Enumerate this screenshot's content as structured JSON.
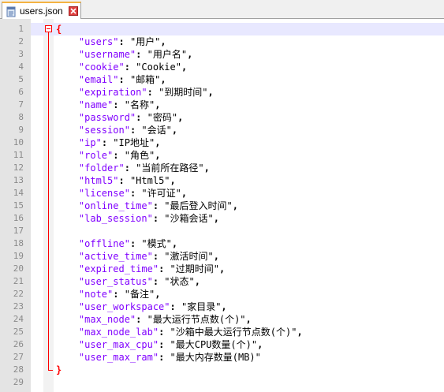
{
  "tab": {
    "label": "users.json",
    "icon": "file-icon",
    "close_icon": "close-icon"
  },
  "colors": {
    "key": "#8000ff",
    "brace": "#ff0000",
    "current_line": "#e8e8ff",
    "tab_accent": "#f4b342"
  },
  "lines": [
    {
      "n": "1",
      "type": "open",
      "text": "{"
    },
    {
      "n": "2",
      "type": "kv",
      "key": "\"users\"",
      "value": "\"用户\"",
      "comma": ","
    },
    {
      "n": "3",
      "type": "kv",
      "key": "\"username\"",
      "value": "\"用户名\"",
      "comma": ","
    },
    {
      "n": "4",
      "type": "kv",
      "key": "\"cookie\"",
      "value": "\"Cookie\"",
      "comma": ","
    },
    {
      "n": "5",
      "type": "kv",
      "key": "\"email\"",
      "value": "\"邮箱\"",
      "comma": ","
    },
    {
      "n": "6",
      "type": "kv",
      "key": "\"expiration\"",
      "value": "\"到期时间\"",
      "comma": ","
    },
    {
      "n": "7",
      "type": "kv",
      "key": "\"name\"",
      "value": "\"名称\"",
      "comma": ","
    },
    {
      "n": "8",
      "type": "kv",
      "key": "\"password\"",
      "value": "\"密码\"",
      "comma": ","
    },
    {
      "n": "9",
      "type": "kv",
      "key": "\"session\"",
      "value": "\"会话\"",
      "comma": ","
    },
    {
      "n": "10",
      "type": "kv",
      "key": "\"ip\"",
      "value": "\"IP地址\"",
      "comma": ","
    },
    {
      "n": "11",
      "type": "kv",
      "key": "\"role\"",
      "value": "\"角色\"",
      "comma": ","
    },
    {
      "n": "12",
      "type": "kv",
      "key": "\"folder\"",
      "value": "\"当前所在路径\"",
      "comma": ","
    },
    {
      "n": "13",
      "type": "kv",
      "key": "\"html5\"",
      "value": "\"Html5\"",
      "comma": ","
    },
    {
      "n": "14",
      "type": "kv",
      "key": "\"license\"",
      "value": "\"许可证\"",
      "comma": ","
    },
    {
      "n": "15",
      "type": "kv",
      "key": "\"online_time\"",
      "value": "\"最后登入时间\"",
      "comma": ","
    },
    {
      "n": "16",
      "type": "kv",
      "key": "\"lab_session\"",
      "value": "\"沙箱会话\"",
      "comma": ","
    },
    {
      "n": "17",
      "type": "blank"
    },
    {
      "n": "18",
      "type": "kv",
      "key": "\"offline\"",
      "value": "\"模式\"",
      "comma": ","
    },
    {
      "n": "19",
      "type": "kv",
      "key": "\"active_time\"",
      "value": "\"激活时间\"",
      "comma": ","
    },
    {
      "n": "20",
      "type": "kv",
      "key": "\"expired_time\"",
      "value": "\"过期时间\"",
      "comma": ","
    },
    {
      "n": "21",
      "type": "kv",
      "key": "\"user_status\"",
      "value": "\"状态\"",
      "comma": ","
    },
    {
      "n": "22",
      "type": "kv",
      "key": "\"note\"",
      "value": "\"备注\"",
      "comma": ","
    },
    {
      "n": "23",
      "type": "kv",
      "key": "\"user_workspace\"",
      "value": "\"家目录\"",
      "comma": ","
    },
    {
      "n": "24",
      "type": "kv",
      "key": "\"max_node\"",
      "value": "\"最大运行节点数(个)\"",
      "comma": ","
    },
    {
      "n": "25",
      "type": "kv",
      "key": "\"max_node_lab\"",
      "value": "\"沙箱中最大运行节点数(个)\"",
      "comma": ","
    },
    {
      "n": "26",
      "type": "kv",
      "key": "\"user_max_cpu\"",
      "value": "\"最大CPU数量(个)\"",
      "comma": ","
    },
    {
      "n": "27",
      "type": "kv",
      "key": "\"user_max_ram\"",
      "value": "\"最大内存数量(MB)\"",
      "comma": ""
    },
    {
      "n": "28",
      "type": "close",
      "text": "}"
    },
    {
      "n": "29",
      "type": "blank"
    }
  ]
}
